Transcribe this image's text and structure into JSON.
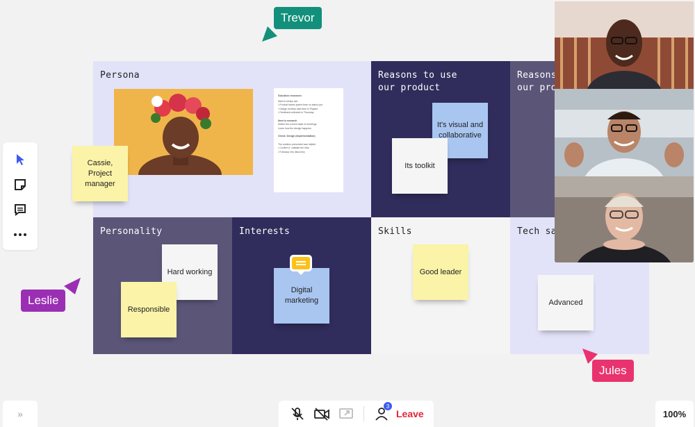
{
  "colors": {
    "persona_bg": "#e2e3f8",
    "dark_navy": "#302c5b",
    "slate": "#5b5678",
    "light_gray": "#f4f4f5",
    "trevor": "#12907c",
    "leslie": "#9a2fb3",
    "jules": "#e8336e",
    "leave": "#e0263a"
  },
  "board": {
    "persona": {
      "title": "Persona",
      "note": "Cassie, Project manager"
    },
    "reasons": {
      "title": "Reasons to use our product",
      "notes": [
        "It's visual and collaborative",
        "Its toolkit"
      ]
    },
    "reasons2": {
      "title": "Reasons to use our product"
    },
    "personality": {
      "title": "Personality",
      "notes": [
        "Hard working",
        "Responsible"
      ]
    },
    "interests": {
      "title": "Interests",
      "notes": [
        "Digital marketing"
      ]
    },
    "skills": {
      "title": "Skills",
      "notes": [
        "Good leader"
      ]
    },
    "tech": {
      "title": "Tech savvy",
      "notes": [
        "Advanced"
      ]
    }
  },
  "document": {
    "heading": "Solution research",
    "lines": [
      "Meet & kit tips are:",
      "• Product teams spend time on stand-ups",
      "• Design reviews take time in Playlist",
      "• Feedback collected in Thursday",
      "Next to research",
      "Define the current state of meetings",
      "Learn how the design happens",
      "Check: Design (implementation)",
      "The solution presented was helpful",
      "• Confirm it, validate the idea",
      "• Followup into discovery"
    ]
  },
  "toolbar": {
    "items": [
      "select-tool",
      "sticky-note-tool",
      "comment-tool",
      "more-tool"
    ]
  },
  "cursors": {
    "trevor": "Trevor",
    "leslie": "Leslie",
    "jules": "Jules"
  },
  "call": {
    "participants_count": "3",
    "leave_label": "Leave"
  },
  "zoom": {
    "level": "100%"
  },
  "collapse": {
    "label": "»"
  }
}
